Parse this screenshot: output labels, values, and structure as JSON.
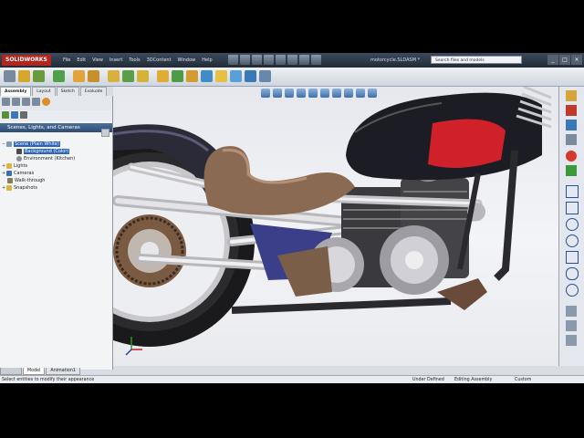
{
  "app": {
    "brand": "SOLIDWORKS",
    "document_title": "motorcycle.SLDASM *"
  },
  "menu": [
    "File",
    "Edit",
    "View",
    "Insert",
    "Tools",
    "3DContent",
    "Window",
    "Help"
  ],
  "search": {
    "placeholder": "Search files and models"
  },
  "window_controls": [
    "_",
    "□",
    "×"
  ],
  "command_tabs": [
    {
      "label": "Assembly",
      "active": true
    },
    {
      "label": "Layout",
      "active": false
    },
    {
      "label": "Sketch",
      "active": false
    },
    {
      "label": "Evaluate",
      "active": false
    }
  ],
  "left_panel": {
    "title": "Scenes, Lights, and Cameras",
    "tree": [
      {
        "label": "Scene (Plain White)",
        "selected": true
      },
      {
        "label": "Background (Color)",
        "selected": true
      },
      {
        "label": "Environment (Kitchen)",
        "selected": false
      },
      {
        "label": "Lights",
        "selected": false
      },
      {
        "label": "Cameras",
        "selected": false
      },
      {
        "label": "Walk-through",
        "selected": false
      },
      {
        "label": "Snapshots",
        "selected": false
      }
    ]
  },
  "bottom_tabs": [
    {
      "label": "Model",
      "active": true
    },
    {
      "label": "Animation1",
      "active": false
    }
  ],
  "status": {
    "hint": "Select entities to modify their appearance",
    "state": "Under Defined",
    "mode": "Editing Assembly",
    "units": "Custom"
  },
  "colors": {
    "selection": "#2a63b8",
    "brand_red": "#b3261e",
    "tank_red": "#d0202a",
    "frame_blue": "#3b3f8a",
    "seat_brown": "#8a6a52"
  }
}
